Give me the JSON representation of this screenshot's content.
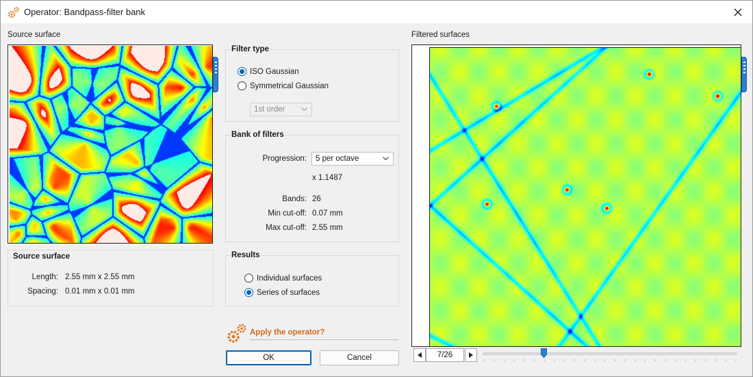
{
  "window": {
    "title": "Operator: Bandpass-filter bank"
  },
  "source_panel": {
    "label": "Source surface"
  },
  "filtered_panel": {
    "label": "Filtered surfaces",
    "navigation": {
      "current_page": "7/26",
      "slider_fraction": 0.24
    }
  },
  "filter_type": {
    "title": "Filter type",
    "options": [
      {
        "label": "ISO Gaussian",
        "selected": true
      },
      {
        "label": "Symmetrical Gaussian",
        "selected": false
      }
    ],
    "order_select": {
      "value": "1st order",
      "disabled": true
    }
  },
  "bank_of_filters": {
    "title": "Bank of filters",
    "progression_label": "Progression:",
    "progression_value": "5 per octave",
    "ratio_text": "x 1.1487",
    "bands_label": "Bands:",
    "bands_value": "26",
    "min_cutoff_label": "Min cut-off:",
    "min_cutoff_value": "0.07 mm",
    "max_cutoff_label": "Max cut-off:",
    "max_cutoff_value": "2.55 mm"
  },
  "source_info": {
    "title": "Source surface",
    "length_label": "Length:",
    "length_value": "2.55 mm x 2.55 mm",
    "spacing_label": "Spacing:",
    "spacing_value": "0.01 mm x 0.01 mm"
  },
  "results": {
    "title": "Results",
    "options": [
      {
        "label": "Individual surfaces",
        "selected": false
      },
      {
        "label": "Series of surfaces",
        "selected": true
      }
    ]
  },
  "apply": {
    "label": "Apply the operator?"
  },
  "buttons": {
    "ok_label": "OK",
    "cancel_label": "Cancel"
  },
  "colors": {
    "accent": "#0063b1",
    "apply_orange": "#d4691c",
    "scroll_tab": "#2d7fd3"
  },
  "icons": {
    "title": "gears-icon",
    "close": "close-icon",
    "apply": "gears-icon",
    "nav_prev": "triangle-left-icon",
    "nav_next": "triangle-right-icon"
  }
}
